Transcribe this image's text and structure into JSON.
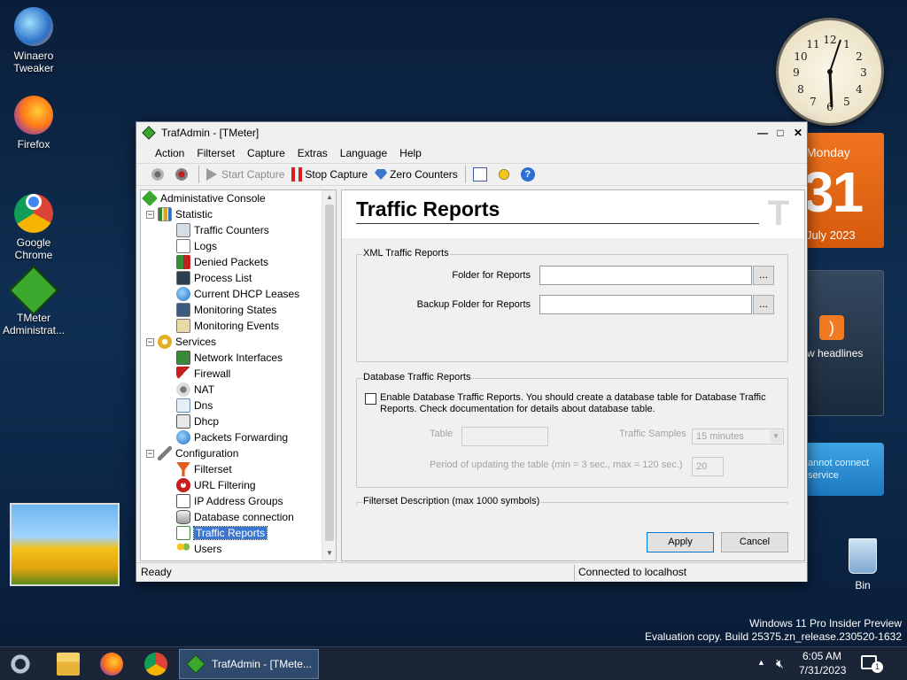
{
  "desktop": {
    "icons": [
      {
        "label": "Winaero Tweaker"
      },
      {
        "label": "Firefox"
      },
      {
        "label": "Google Chrome"
      },
      {
        "label": "TMeter Administrat..."
      }
    ],
    "recycle_bin": "Bin",
    "clock": {
      "numbers": [
        "12",
        "1",
        "2",
        "3",
        "4",
        "5",
        "6",
        "7",
        "8",
        "9",
        "10",
        "11"
      ]
    },
    "calendar": {
      "day_name": "Monday",
      "day_number": "31",
      "month_year": "July 2023"
    },
    "rss": {
      "text": "w headlines"
    },
    "weather": {
      "text": "annot connect service"
    },
    "watermark": {
      "line1": "Windows 11 Pro Insider Preview",
      "line2": "Evaluation copy. Build 25375.zn_release.230520-1632"
    }
  },
  "window": {
    "title": "TrafAdmin - [TMeter]",
    "controls": {
      "minimize": "—",
      "maximize": "□",
      "close": "✕"
    },
    "menu": [
      "Action",
      "Filterset",
      "Capture",
      "Extras",
      "Language",
      "Help"
    ],
    "toolbar": {
      "start_capture": "Start Capture",
      "stop_capture": "Stop Capture",
      "zero_counters": "Zero Counters"
    },
    "tree": {
      "root": "Administative Console",
      "statistic": "Statistic",
      "statistic_items": [
        "Traffic Counters",
        "Logs",
        "Denied Packets",
        "Process List",
        "Current DHCP Leases",
        "Monitoring States",
        "Monitoring Events"
      ],
      "services": "Services",
      "services_items": [
        "Network Interfaces",
        "Firewall",
        "NAT",
        "Dns",
        "Dhcp",
        "Packets Forwarding"
      ],
      "configuration": "Configuration",
      "configuration_items": [
        "Filterset",
        "URL Filtering",
        "IP Address Groups",
        "Database connection",
        "Traffic Reports",
        "Users"
      ],
      "expand_symbol": "−",
      "scroll_up": "▲",
      "scroll_down": "▼"
    },
    "panel": {
      "heading": "Traffic Reports",
      "logo_char": "T",
      "xml_group": {
        "legend": "XML Traffic Reports",
        "folder_label": "Folder for Reports",
        "folder_value": "",
        "backup_label": "Backup Folder for Reports",
        "backup_value": "",
        "browse": "..."
      },
      "db_group": {
        "legend": "Database Traffic Reports",
        "enable_text": "Enable Database Traffic Reports. You should create a database table for Database Traffic Reports. Check documentation for details about database table.",
        "table_label": "Table",
        "table_value": "",
        "samples_label": "Traffic Samples",
        "samples_value": "15 minutes",
        "period_label": "Period of updating the table (min = 3 sec., max = 120 sec.)",
        "period_value": "20"
      },
      "filterset_group": {
        "legend": "Filterset Description (max 1000 symbols)"
      },
      "apply": "Apply",
      "cancel": "Cancel"
    },
    "status": {
      "left": "Ready",
      "right": "Connected to localhost"
    }
  },
  "taskbar": {
    "active_task": "TrafAdmin - [TMete...",
    "time": "6:05 AM",
    "date": "7/31/2023",
    "notification_count": "1",
    "chevron": "▲"
  },
  "colors": {
    "accent": "#3b77d1",
    "calendar": "#e86416",
    "taskbar": "#1a2538"
  }
}
